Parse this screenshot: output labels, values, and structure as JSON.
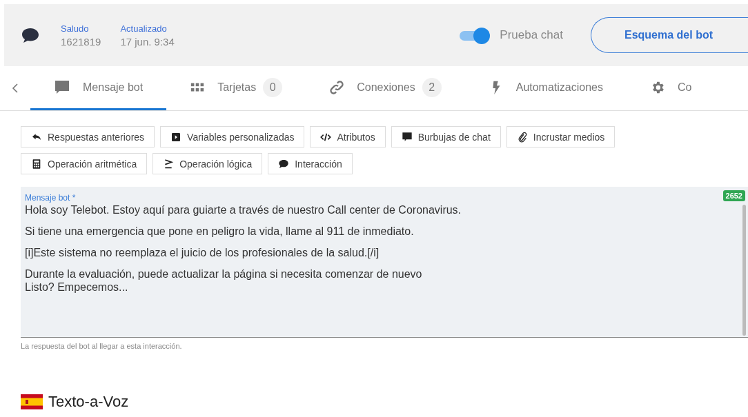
{
  "header": {
    "stats": [
      {
        "label": "Saludo",
        "value": "1621819"
      },
      {
        "label": "Actualizado",
        "value": "17 jun. 9:34"
      }
    ],
    "toggle": {
      "label": "Prueba chat",
      "on": true
    },
    "button": "Esquema del bot"
  },
  "tabs": [
    {
      "kind": "message",
      "label": "Mensaje bot",
      "selected": true
    },
    {
      "kind": "cards",
      "label": "Tarjetas",
      "count": "0",
      "selected": false
    },
    {
      "kind": "link",
      "label": "Conexiones",
      "count": "2",
      "selected": false
    },
    {
      "kind": "bolt",
      "label": "Automatizaciones",
      "selected": false
    },
    {
      "kind": "gear",
      "label": "Co",
      "selected": false
    }
  ],
  "tools": [
    [
      {
        "kind": "reply",
        "label": "Respuestas anteriores"
      },
      {
        "kind": "var",
        "label": "Variables personalizadas"
      },
      {
        "kind": "code",
        "label": "Atributos"
      },
      {
        "kind": "bubble",
        "label": "Burbujas de chat"
      },
      {
        "kind": "clip",
        "label": "Incrustar medios"
      }
    ],
    [
      {
        "kind": "calc",
        "label": "Operación aritmética"
      },
      {
        "kind": "gte",
        "label": "Operación lógica"
      },
      {
        "kind": "chat",
        "label": "Interacción"
      }
    ]
  ],
  "message": {
    "label": "Mensaje bot *",
    "counter": "2652",
    "paragraphs": [
      [
        "Hola soy Telebot. Estoy aquí para guiarte a través de nuestro Call center de Coronavirus."
      ],
      [
        "Si tiene una emergencia que pone en peligro la vida, llame al 911 de inmediato."
      ],
      [
        "[i]Este sistema no reemplaza el juicio de los profesionales de la salud.[/i]"
      ],
      [
        "Durante la evaluación, puede actualizar la página si necesita comenzar de nuevo",
        "Listo? Empecemos..."
      ]
    ],
    "hint": "La respuesta del bot al llegar a esta interacción."
  },
  "tts": {
    "title": "Texto-a-Voz"
  }
}
